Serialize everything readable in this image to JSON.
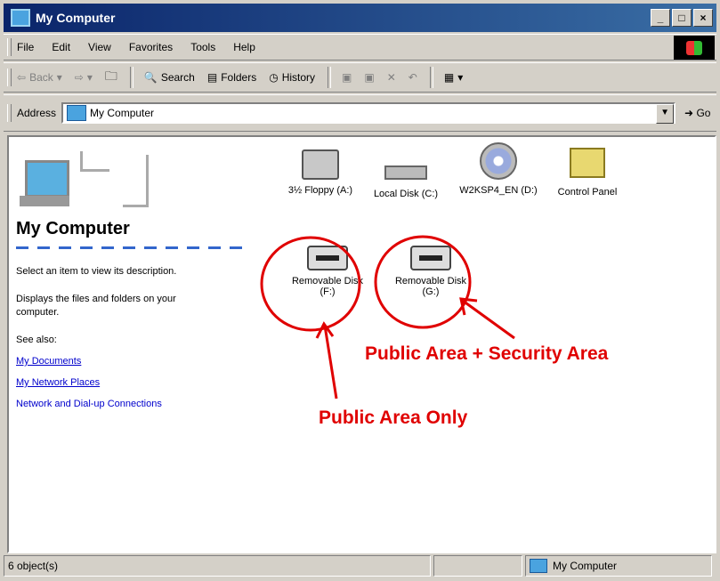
{
  "window": {
    "title": "My Computer",
    "buttons": [
      "_",
      "□",
      "×"
    ]
  },
  "menu": [
    "File",
    "Edit",
    "View",
    "Favorites",
    "Tools",
    "Help"
  ],
  "toolbar": {
    "back": "Back",
    "search": "Search",
    "folders": "Folders",
    "history": "History"
  },
  "address": {
    "label": "Address",
    "value": "My Computer",
    "go": "Go"
  },
  "left_pane": {
    "title": "My Computer",
    "hint": "Select an item to view its description.",
    "desc": "Displays the files and folders on your computer.",
    "see_also": "See also:",
    "links": [
      "My Documents",
      "My Network Places",
      "Network and Dial-up Connections"
    ]
  },
  "items": [
    {
      "label": "3½ Floppy (A:)",
      "icon": "floppy-drive-icon"
    },
    {
      "label": "Local Disk (C:)",
      "icon": "hard-disk-icon"
    },
    {
      "label": "W2KSP4_EN (D:)",
      "icon": "cd-drive-icon"
    },
    {
      "label": "Control Panel",
      "icon": "control-panel-icon"
    },
    {
      "label": "Removable Disk (F:)",
      "icon": "removable-disk-icon"
    },
    {
      "label": "Removable Disk (G:)",
      "icon": "removable-disk-icon"
    }
  ],
  "annotations": {
    "security": "Public Area + Security Area",
    "public": "Public Area Only",
    "color": "#e00000"
  },
  "status": {
    "left": "6 object(s)",
    "right": "My Computer"
  }
}
